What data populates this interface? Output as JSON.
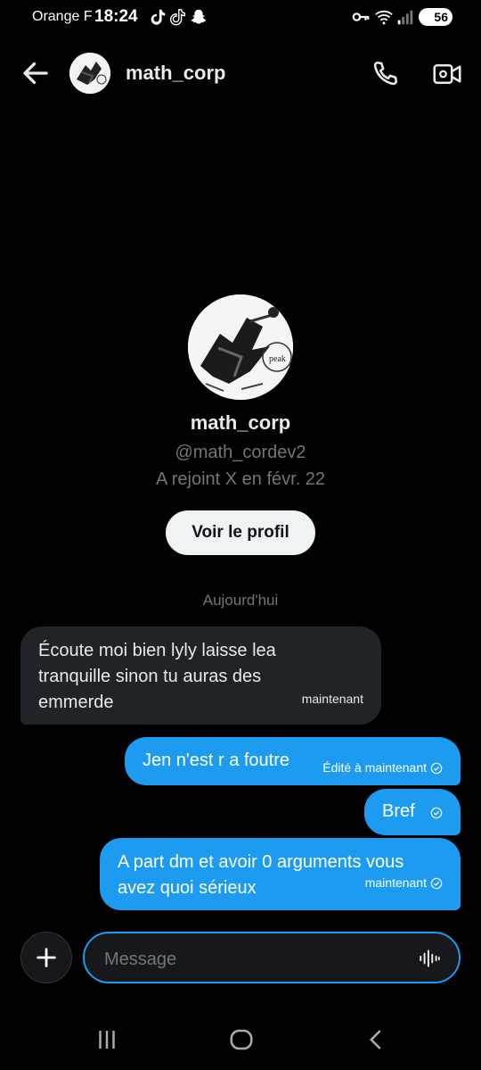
{
  "status_bar": {
    "carrier": "Orange F",
    "time": "18:24",
    "battery": "56",
    "icons": [
      "tiktok-icon",
      "tiktok-icon",
      "snapchat-icon",
      "key-icon",
      "wifi-icon",
      "signal-icon"
    ]
  },
  "header": {
    "name": "math_corp",
    "icons": [
      "back-arrow-icon",
      "phone-icon",
      "video-icon"
    ]
  },
  "profile": {
    "name": "math_corp",
    "handle": "@math_cordev2",
    "joined": "A rejoint X en févr. 22",
    "button_label": "Voir le profil",
    "avatar_text": "peak"
  },
  "conversation": {
    "day_label": "Aujourd'hui",
    "messages": [
      {
        "direction": "in",
        "text": "Écoute moi bien lyly laisse lea\ntranquille sinon tu auras des\nemmerde",
        "meta": "maintenant"
      },
      {
        "direction": "out",
        "text": "Jen n'est r a foutre",
        "meta": "Édité à maintenant"
      },
      {
        "direction": "out",
        "text": "Bref",
        "meta": ""
      },
      {
        "direction": "out",
        "text": "A part dm et avoir  0 arguments  vous\navez  quoi sérieux",
        "meta": "maintenant"
      }
    ]
  },
  "composer": {
    "placeholder": "Message"
  },
  "colors": {
    "accent": "#1d9bf0",
    "background": "#000000",
    "incoming_bubble": "#202327",
    "muted_text": "#71767b"
  }
}
